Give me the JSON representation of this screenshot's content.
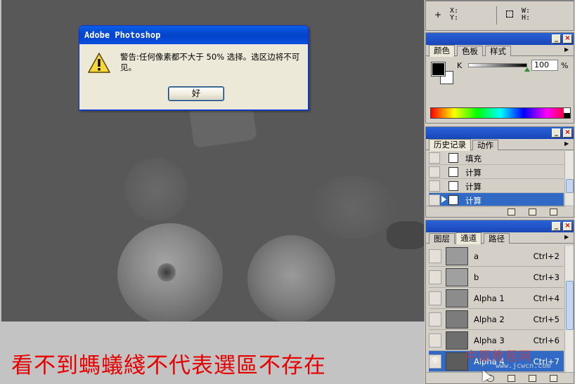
{
  "dialog": {
    "title": "Adobe Photoshop",
    "message": "警告:任何像素都不大于 50% 选择。选区边将不可见。",
    "ok_label": "好"
  },
  "caption": "看不到螞蟻綫不代表選區不存在",
  "info_panel": {
    "xy_label": "X: Y:",
    "wh_label": "W: H:"
  },
  "color_panel": {
    "tabs": [
      "颜色",
      "色板",
      "样式"
    ],
    "channel_label": "K",
    "value": "100",
    "unit": "%"
  },
  "history_panel": {
    "tabs": [
      "历史记录",
      "动作"
    ],
    "items": [
      {
        "label": "填充",
        "selected": false
      },
      {
        "label": "计算",
        "selected": false
      },
      {
        "label": "计算",
        "selected": false
      },
      {
        "label": "计算",
        "selected": true
      }
    ]
  },
  "channels_panel": {
    "tabs": [
      "图层",
      "通道",
      "路径"
    ],
    "channels": [
      {
        "name": "a",
        "shortcut": "Ctrl+2",
        "visible": false,
        "selected": false
      },
      {
        "name": "b",
        "shortcut": "Ctrl+3",
        "visible": false,
        "selected": false
      },
      {
        "name": "Alpha 1",
        "shortcut": "Ctrl+4",
        "visible": false,
        "selected": false
      },
      {
        "name": "Alpha 2",
        "shortcut": "Ctrl+5",
        "visible": false,
        "selected": false
      },
      {
        "name": "Alpha 3",
        "shortcut": "Ctrl+6",
        "visible": false,
        "selected": false
      },
      {
        "name": "Alpha 4",
        "shortcut": "Ctrl+7",
        "visible": true,
        "selected": true
      }
    ]
  },
  "watermark": {
    "text": "中国教程网",
    "url": "www.jcwcn.com"
  },
  "colors": {
    "accent": "#316ac5",
    "caption": "#e60000",
    "canvas": "#585858"
  }
}
